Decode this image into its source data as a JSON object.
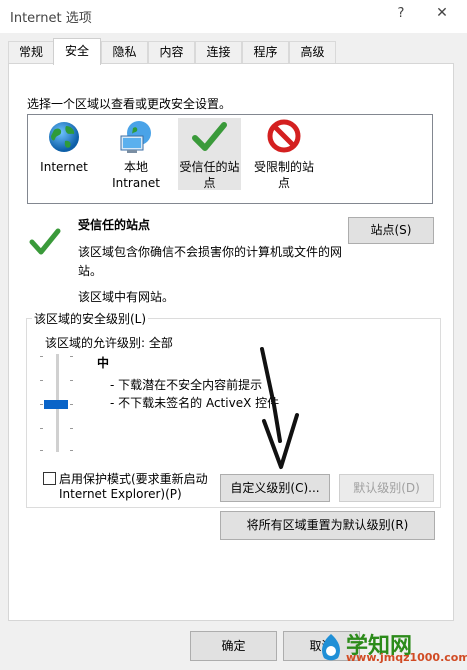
{
  "window": {
    "title": "Internet 选项",
    "help": "?",
    "close": "✕"
  },
  "tabs": [
    {
      "label": "常规"
    },
    {
      "label": "安全"
    },
    {
      "label": "隐私"
    },
    {
      "label": "内容"
    },
    {
      "label": "连接"
    },
    {
      "label": "程序"
    },
    {
      "label": "高级"
    }
  ],
  "active_tab": "安全",
  "security": {
    "zone_prompt": "选择一个区域以查看或更改安全设置。",
    "zones": [
      {
        "line1": "Internet",
        "line2": "",
        "icon": "globe-icon"
      },
      {
        "line1": "本地",
        "line2": "Intranet",
        "icon": "local-intranet-icon"
      },
      {
        "line1": "受信任的站",
        "line2": "点",
        "icon": "checkmark-icon"
      },
      {
        "line1": "受限制的站",
        "line2": "点",
        "icon": "restricted-icon"
      }
    ],
    "selected_zone": "受信任的站点",
    "zone_title": "受信任的站点",
    "zone_desc": "该区域包含你确信不会损害你的计算机或文件的网站。",
    "zone_note": "该区域中有网站。",
    "sites_button": "站点(S)",
    "level_group_title": "该区域的安全级别(L)",
    "allowed_levels": "该区域的允许级别: 全部",
    "level_name": "中",
    "level_bullets": [
      "- 下载潜在不安全内容前提示",
      "- 不下载未签名的 ActiveX 控件"
    ],
    "slider_level": "中",
    "protected_mode_line1": "启用保护模式(要求重新启动",
    "protected_mode_line2": "Internet Explorer)(P)",
    "protected_mode_checked": false,
    "custom_level_button": "自定义级别(C)...",
    "default_level_button": "默认级别(D)",
    "reset_all_button": "将所有区域重置为默认级别(R)"
  },
  "footer": {
    "ok_button": "确定",
    "cancel_button": "取消"
  },
  "watermark": {
    "text": "学知网",
    "url": "www.jmqz1000.com"
  },
  "colors": {
    "accent": "#0078d7",
    "check_green": "#3a9a3a",
    "restricted_red": "#d42020",
    "slider_thumb": "#0a64c8"
  }
}
